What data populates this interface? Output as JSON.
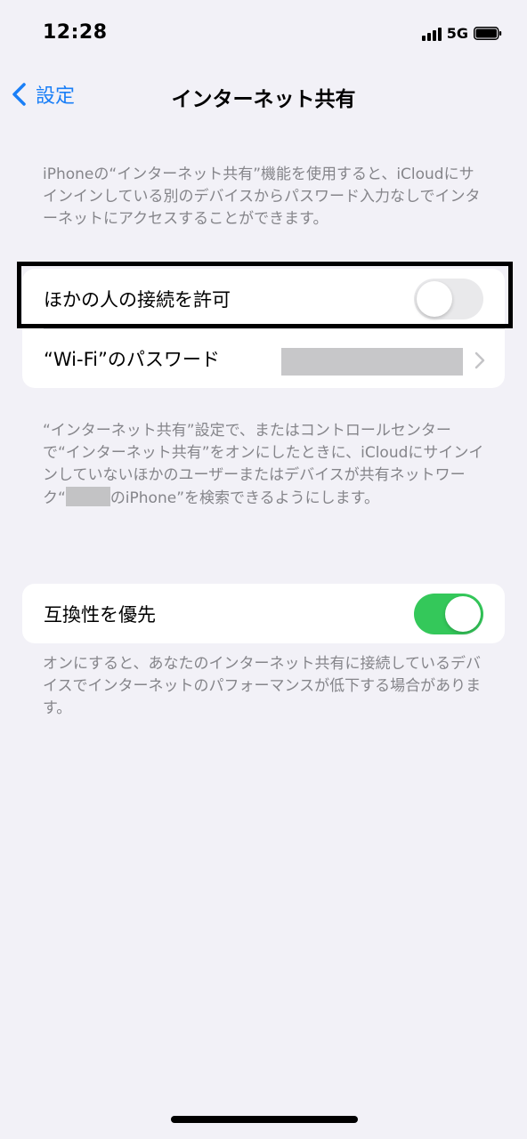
{
  "status_bar": {
    "time": "12:28",
    "network": "5G",
    "icons": [
      "signal-bars-icon",
      "battery-icon"
    ]
  },
  "nav": {
    "back_label": "設定",
    "title": "インターネット共有"
  },
  "descriptions": {
    "top": "iPhoneの“インターネット共有”機能を使用すると、iCloudにサインインしている別のデバイスからパスワード入力なしでインターネットにアクセスすることができます。",
    "middle_before": "“インターネット共有”設定で、またはコントロールセンターで“インターネット共有”をオンにしたときに、iCloudにサインインしていないほかのユーザーまたはデバイスが共有ネットワーク“",
    "middle_after": "のiPhone”を検索できるようにします。",
    "bottom": "オンにすると、あなたのインターネット共有に接続しているデバイスでインターネットのパフォーマンスが低下する場合があります。"
  },
  "settings": {
    "allow_others": {
      "label": "ほかの人の接続を許可",
      "enabled": false
    },
    "wifi_password": {
      "label": "“Wi-Fi”のパスワード"
    },
    "maximize_compatibility": {
      "label": "互換性を優先",
      "enabled": true
    }
  },
  "colors": {
    "accent": "#1a7ff7",
    "toggle_on": "#34c85a",
    "toggle_off": "#e9e9eb",
    "background": "#f2f1f7",
    "secondary_text": "#85858a"
  }
}
